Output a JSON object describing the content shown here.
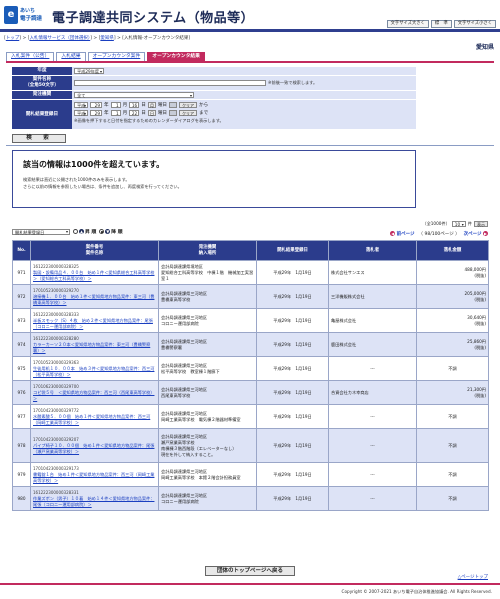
{
  "header": {
    "logo_badge": "e",
    "logo_line1": "あいち",
    "logo_line2": "電子調達",
    "title": "電子調達共同システム（物品等）",
    "font_buttons": [
      "文字サイズ大きく",
      "標　準",
      "文字サイズ小さく"
    ]
  },
  "breadcrumb": {
    "top": "トップ",
    "sep1": " > ",
    "service": "入札情報サービス（団体選択）",
    "sep2": " > ",
    "org": "愛知県",
    "sep3": " > ",
    "current": "入札情報-オープンカウンタ結果"
  },
  "org_name": "愛知県",
  "tabs": [
    "入札案件（公告）",
    "入札結果",
    "オープンカウンタ案件",
    "オープンカウンタ結果"
  ],
  "form": {
    "year_label": "年度",
    "year_value": "平成29年度",
    "case_name_label": "案件名称",
    "case_name_sub": "（全角50文字）",
    "case_name_value": "",
    "case_name_note": "※前後一致で検索します。",
    "org_label": "発注機関",
    "org_value": "全て",
    "date_label": "開札結果登録日",
    "era1": "平成",
    "y1": "29",
    "u_year": "年",
    "m1": "1",
    "u_month": "月",
    "d1": "16",
    "u_day": "日",
    "wd1": "月",
    "u_weekday": "曜日",
    "clear": "クリア",
    "from": "から",
    "era2": "平成",
    "y2": "29",
    "m2": "1",
    "d2": "22",
    "wd2": "日",
    "to": "まで",
    "date_note": "※画像を押下すると日付を指定するためのカレンダーダイアログを表示します。",
    "search_button": "検　索"
  },
  "message": {
    "title": "該当の情報は1000件を超えています。",
    "line1": "検索結果は直近に公開された1000件のみを表示します。",
    "line2": "さらに以前の情報を参照したい場合は、条件を追加し、再度検索を行ってください。"
  },
  "sort": {
    "field": "開札結果登録日",
    "asc_label": "昇 順",
    "desc_label": "降 順"
  },
  "paging": {
    "total": "（全1000件）",
    "per_page": "10",
    "per_page_unit": "件",
    "show_button": "表示",
    "prev": "前ページ",
    "page_status": "（ 98/100ページ ）",
    "next": "次ページ"
  },
  "table": {
    "headers": [
      "No.",
      "案件番号\n案件名称",
      "発注機関\n納入場所",
      "開札結果登録日",
      "落札者",
      "落札金額"
    ],
    "rows": [
      {
        "no": "971",
        "case_no": "161222300000328325",
        "case_name": "製図・設備用品４．００台　始め１件＜愛知県総合工科高等学校＞（愛知総合工科高等学校）＞",
        "org": "会計局調達課県境地区\n愛知総合工科高等学校　中棟１階　機械加工実習室１",
        "date": "平成29年　1月19日",
        "winner": "株式会社サンエス",
        "amount": "488,000円\n(税抜)"
      },
      {
        "no": "972",
        "case_no": "170105230000329270",
        "case_name": "溶接機１．００台　始め１件＜愛知県地方物品案件：東三河（豊橋東高等学校）＞",
        "org": "会計局調達課県三河地区\n豊橋東高等学校",
        "date": "平成29年　1月19日",
        "winner": "三洋機販株式会社",
        "amount": "205,000円\n(税抜)"
      },
      {
        "no": "973",
        "case_no": "161222300000328333",
        "case_name": "半板スモック（S）４枚　始め２件＜愛知県地方物品案件：尾張（コロニー運用部病院）＞",
        "org": "会計局調達課県三河地区\nコロニー運用部病院",
        "date": "平成29年　1月19日",
        "winner": "亀屋株式会社",
        "amount": "30,640円\n(税抜)"
      },
      {
        "no": "974",
        "case_no": "161222300000328280",
        "case_name": "カラーカーソ２０本＜愛知県地方物品案件：東三河（豊橋警察署）＞",
        "org": "会計局調達課県三河地区\n豊橋警察署",
        "date": "平成29年　1月19日",
        "winner": "鹿田株式会社",
        "amount": "25,860円\n(税抜)"
      },
      {
        "no": "975",
        "case_no": "170105230000329363",
        "case_name": "生徒用机１０．００本　始め３件＜愛知県地方物品案件：西三河（松平高等学校）＞",
        "org": "会計局調達課県三河地区\n松平高等学校　教室棟１階廊下",
        "date": "平成29年　1月19日",
        "winner": "---",
        "amount": "不調"
      },
      {
        "no": "976",
        "case_no": "170106230000329700",
        "case_name": "コピ袋５号　＜愛知県地方物品案件：西三河（西尾東高等学校）＞",
        "org": "会計局調達課県三河地区\n西尾東高等学校",
        "date": "平成29年　1月19日",
        "winner": "合資会社カネ幸商店",
        "amount": "21,300円\n(税抜)"
      },
      {
        "no": "977",
        "case_no": "170104230000329772",
        "case_name": "水酸素酸５．００個　始め１件＜愛知県地方物品案件：西三河（岡崎工業高等学校）＞",
        "org": "会計局調達課県三河地区\n岡崎工業高等学校　電気棟２階器材準備室",
        "date": "平成29年　1月19日",
        "winner": "---",
        "amount": "不調"
      },
      {
        "no": "978",
        "case_no": "170104230000329207",
        "case_name": "パイプ椅子１０．００個　始め１件＜愛知県地方物品案件：尾張（瀬戸窯業高等学校）＞",
        "org": "会計局調達課県三河地区\n瀬戸窯業高等学校\n南棟棟３階西階段（エレベーターなし）\n現在を外して納入すること。",
        "date": "平成29年　1月19日",
        "winner": "---",
        "amount": "不調"
      },
      {
        "no": "979",
        "case_no": "170104230000329173",
        "case_name": "書籍錠１台　始め１件＜愛知県地方物品案件：西三河（岡崎工業高等学校）＞",
        "org": "会計局調達課県三河地区\n岡崎工業高等学校　本館２階会計担務員室",
        "date": "平成29年　1月19日",
        "winner": "---",
        "amount": "不調"
      },
      {
        "no": "980",
        "case_no": "161222300000328331",
        "case_name": "作業ズボン（男子）１０着　始め１４件＜愛知県地方物品案件：尾張（コロニー運用部病院）＞",
        "org": "会計局調達課県三河地区\nコロニー運用部病院",
        "date": "平成29年　1月19日",
        "winner": "---",
        "amount": "不調"
      }
    ]
  },
  "back_button": "団体のトップページへ戻る",
  "page_top": "△ページトップ",
  "copyright": "Copyright © 2007-2021 あいち電子自治体推進協議会. All Rights Reserved."
}
